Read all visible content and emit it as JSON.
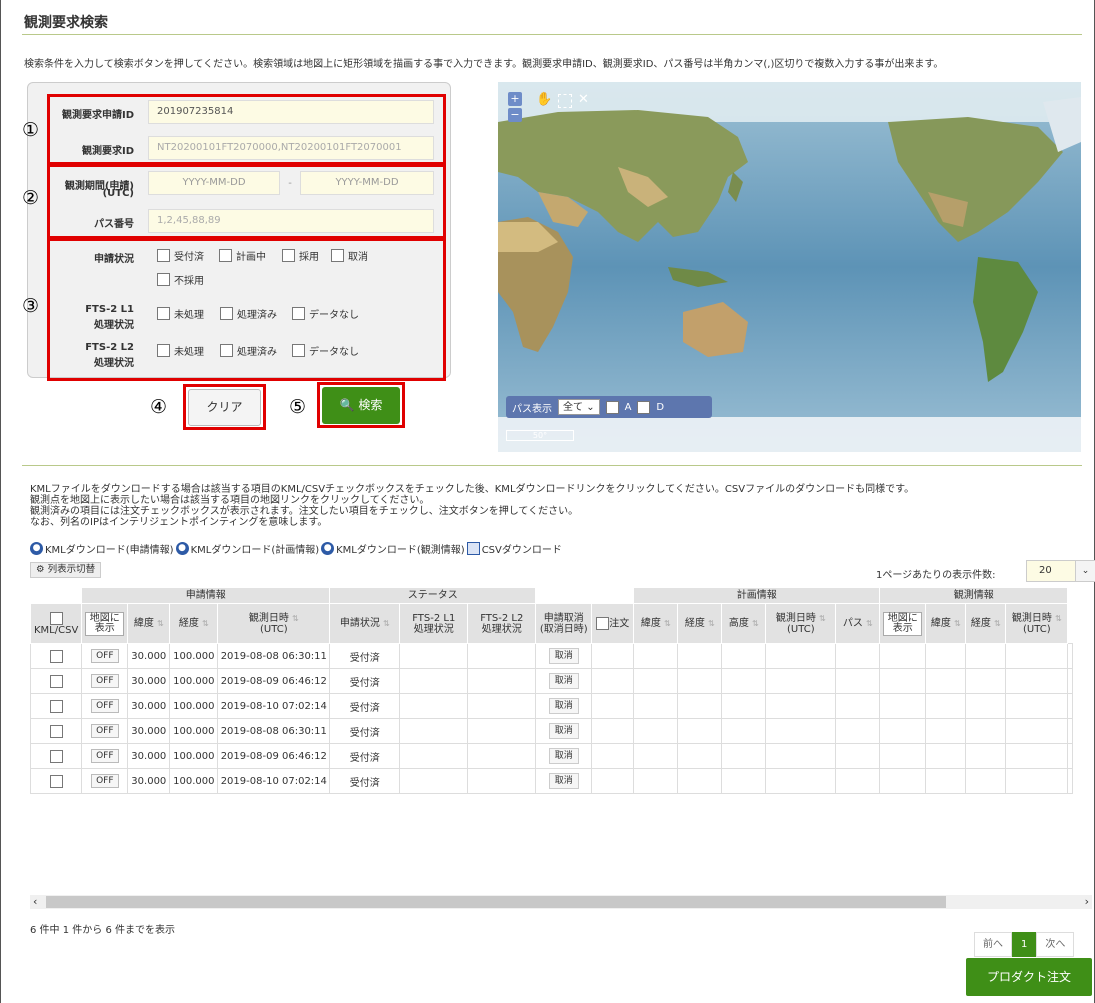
{
  "page": {
    "title": "観測要求検索",
    "intro": "検索条件を入力して検索ボタンを押してください。検索領域は地図上に矩形領域を描画する事で入力できます。観測要求申請ID、観測要求ID、パス番号は半角カンマ(,)区切りで複数入力する事が出来ます。"
  },
  "form": {
    "request_app_id_label": "観測要求申請ID",
    "request_app_id_value": "201907235814",
    "request_id_label": "観測要求ID",
    "request_id_placeholder": "NT20200101FT2070000,NT20200101FT2070001",
    "period_label_1": "観測期間(申請)",
    "period_label_2": "(UTC)",
    "date_from_placeholder": "YYYY-MM-DD",
    "date_sep": "-",
    "date_to_placeholder": "YYYY-MM-DD",
    "path_label": "パス番号",
    "path_placeholder": "1,2,45,88,89",
    "status_label": "申請状況",
    "status_options": [
      "受付済",
      "計画中",
      "採用",
      "取消",
      "不採用"
    ],
    "l1_label_1": "FTS-2 L1",
    "l1_label_2": "処理状況",
    "l2_label_1": "FTS-2 L2",
    "l2_label_2": "処理状況",
    "proc_options": [
      "未処理",
      "処理済み",
      "データなし"
    ],
    "clear_button": "クリア",
    "search_button": "検索"
  },
  "annotations": [
    "①",
    "②",
    "③",
    "④",
    "⑤"
  ],
  "map": {
    "zoom_in": "+",
    "zoom_out": "−",
    "pass_display_label": "パス表示",
    "pass_display_value": "全て",
    "asc_label": "A",
    "desc_label": "D",
    "scale_label": "50°"
  },
  "notes": [
    "KMLファイルをダウンロードする場合は該当する項目のKML/CSVチェックボックスをチェックした後、KMLダウンロードリンクをクリックしてください。CSVファイルのダウンロードも同様です。",
    "観測点を地図上に表示したい場合は該当する項目の地図リンクをクリックしてください。",
    "観測済みの項目には注文チェックボックスが表示されます。注文したい項目をチェックし、注文ボタンを押してください。",
    "なお、列名のIPはインテリジェントポインティングを意味します。"
  ],
  "downloads": {
    "kml_app": "KMLダウンロード(申請情報)",
    "kml_plan": "KMLダウンロード(計画情報)",
    "kml_obs": "KMLダウンロード(観測情報)",
    "csv": "CSVダウンロード"
  },
  "column_toggle": "列表示切替",
  "per_page_label": "1ページあたりの表示件数:",
  "per_page_value": "20",
  "table": {
    "groups": {
      "app": "申請情報",
      "status": "ステータス",
      "plan": "計画情報",
      "obs": "観測情報"
    },
    "headers": {
      "kml": "KML/CSV",
      "map": "地図に表示",
      "lat": "緯度",
      "lon": "経度",
      "obs_dt": "観測日時",
      "utc": "(UTC)",
      "app_status": "申請状況",
      "l1_1": "FTS-2 L1",
      "l1_2": "処理状況",
      "l2_1": "FTS-2 L2",
      "l2_2": "処理状況",
      "cancel_1": "申請取消",
      "cancel_2": "(取消日時)",
      "order": "注文",
      "alt": "高度",
      "path": "パス"
    },
    "rows": [
      {
        "map": "OFF",
        "lat": "30.000",
        "lon": "100.000",
        "dt": "2019-08-08 06:30:11",
        "status": "受付済",
        "cancel": "取消"
      },
      {
        "map": "OFF",
        "lat": "30.000",
        "lon": "100.000",
        "dt": "2019-08-09 06:46:12",
        "status": "受付済",
        "cancel": "取消"
      },
      {
        "map": "OFF",
        "lat": "30.000",
        "lon": "100.000",
        "dt": "2019-08-10 07:02:14",
        "status": "受付済",
        "cancel": "取消"
      },
      {
        "map": "OFF",
        "lat": "30.000",
        "lon": "100.000",
        "dt": "2019-08-08 06:30:11",
        "status": "受付済",
        "cancel": "取消"
      },
      {
        "map": "OFF",
        "lat": "30.000",
        "lon": "100.000",
        "dt": "2019-08-09 06:46:12",
        "status": "受付済",
        "cancel": "取消"
      },
      {
        "map": "OFF",
        "lat": "30.000",
        "lon": "100.000",
        "dt": "2019-08-10 07:02:14",
        "status": "受付済",
        "cancel": "取消"
      }
    ]
  },
  "result_info": "6 件中 1 件から 6 件までを表示",
  "pager": {
    "prev": "前へ",
    "current": "1",
    "next": "次へ"
  },
  "order_button": "プロダクト注文"
}
